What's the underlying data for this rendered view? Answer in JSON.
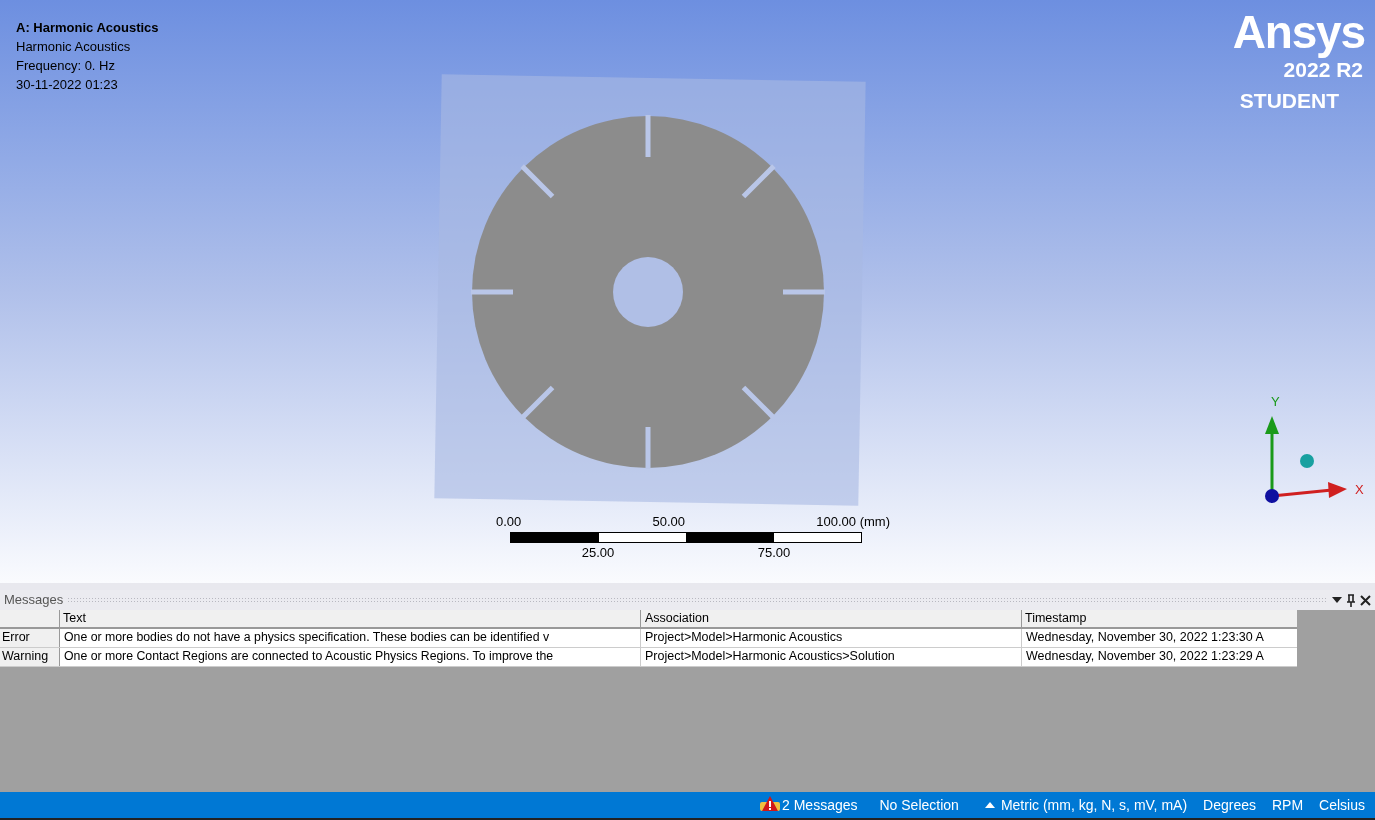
{
  "viewport": {
    "title": "A: Harmonic Acoustics",
    "info": [
      "Harmonic Acoustics",
      "Frequency: 0. Hz",
      "30-11-2022 01:23"
    ],
    "logo": {
      "brand": "Ansys",
      "version": "2022 R2",
      "edition": "STUDENT"
    },
    "scale_bar": {
      "top_labels": [
        "0.00",
        "50.00",
        "100.00 (mm)"
      ],
      "bottom_labels": [
        "25.00",
        "75.00"
      ]
    },
    "triad": {
      "y_label": "Y",
      "x_label": "X"
    }
  },
  "messages": {
    "title": "Messages",
    "columns": [
      "Text",
      "Association",
      "Timestamp"
    ],
    "rows": [
      {
        "severity": "Error",
        "text": "One or more bodies do not have a physics specification. These bodies can be identified v",
        "association": "Project>Model>Harmonic Acoustics",
        "timestamp": "Wednesday, November 30, 2022 1:23:30 A"
      },
      {
        "severity": "Warning",
        "text": "One or more Contact Regions are connected to Acoustic Physics Regions. To improve the",
        "association": "Project>Model>Harmonic Acoustics>Solution",
        "timestamp": "Wednesday, November 30, 2022 1:23:29 A"
      }
    ]
  },
  "status_bar": {
    "messages": "2 Messages",
    "selection": "No Selection",
    "units": "Metric (mm, kg, N, s, mV, mA)",
    "angle": "Degrees",
    "speed": "RPM",
    "temperature": "Celsius"
  }
}
